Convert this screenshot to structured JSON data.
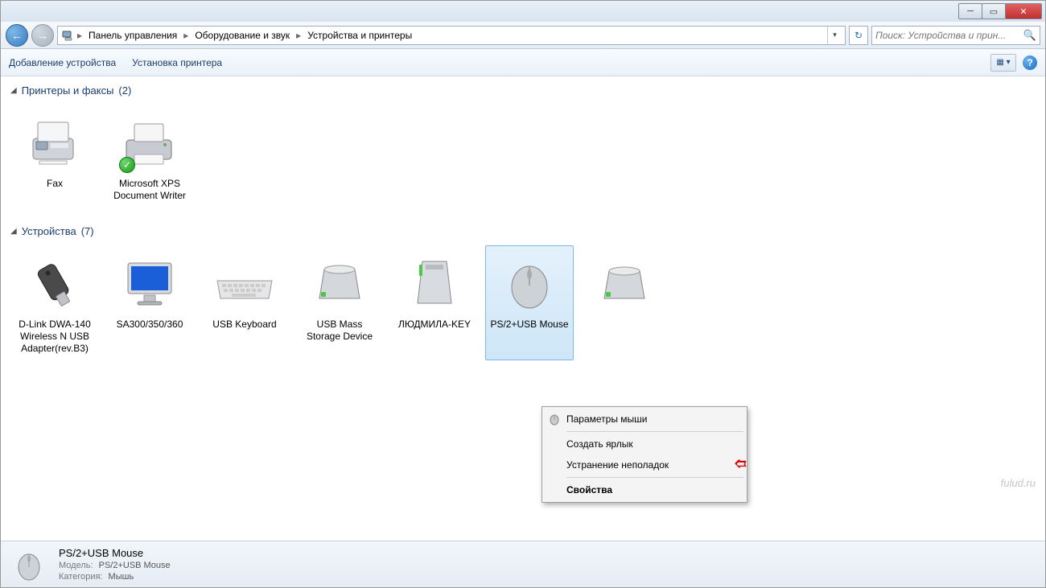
{
  "breadcrumb": {
    "seg1": "Панель управления",
    "seg2": "Оборудование и звук",
    "seg3": "Устройства и принтеры"
  },
  "search": {
    "placeholder": "Поиск: Устройства и прин..."
  },
  "toolbar": {
    "add_device": "Добавление устройства",
    "install_printer": "Установка принтера"
  },
  "groups": {
    "printers": {
      "title": "Принтеры и факсы",
      "count": "(2)"
    },
    "devices": {
      "title": "Устройства",
      "count": "(7)"
    }
  },
  "printers": [
    {
      "label": "Fax",
      "checked": false
    },
    {
      "label": "Microsoft XPS Document Writer",
      "checked": true
    }
  ],
  "devices": [
    {
      "label": "D-Link DWA-140 Wireless N USB Adapter(rev.B3)"
    },
    {
      "label": "SA300/350/360"
    },
    {
      "label": "USB Keyboard"
    },
    {
      "label": "USB Mass Storage Device"
    },
    {
      "label": "ЛЮДМИЛА-KEY"
    },
    {
      "label": "PS/2+USB Mouse",
      "selected": true
    },
    {
      "label": ""
    }
  ],
  "context_menu": {
    "item1": "Параметры мыши",
    "item2": "Создать ярлык",
    "item3": "Устранение неполадок",
    "item4": "Свойства"
  },
  "details": {
    "title": "PS/2+USB Mouse",
    "model_k": "Модель:",
    "model_v": "PS/2+USB Mouse",
    "category_k": "Категория:",
    "category_v": "Мышь"
  },
  "watermark": "fulud.ru"
}
